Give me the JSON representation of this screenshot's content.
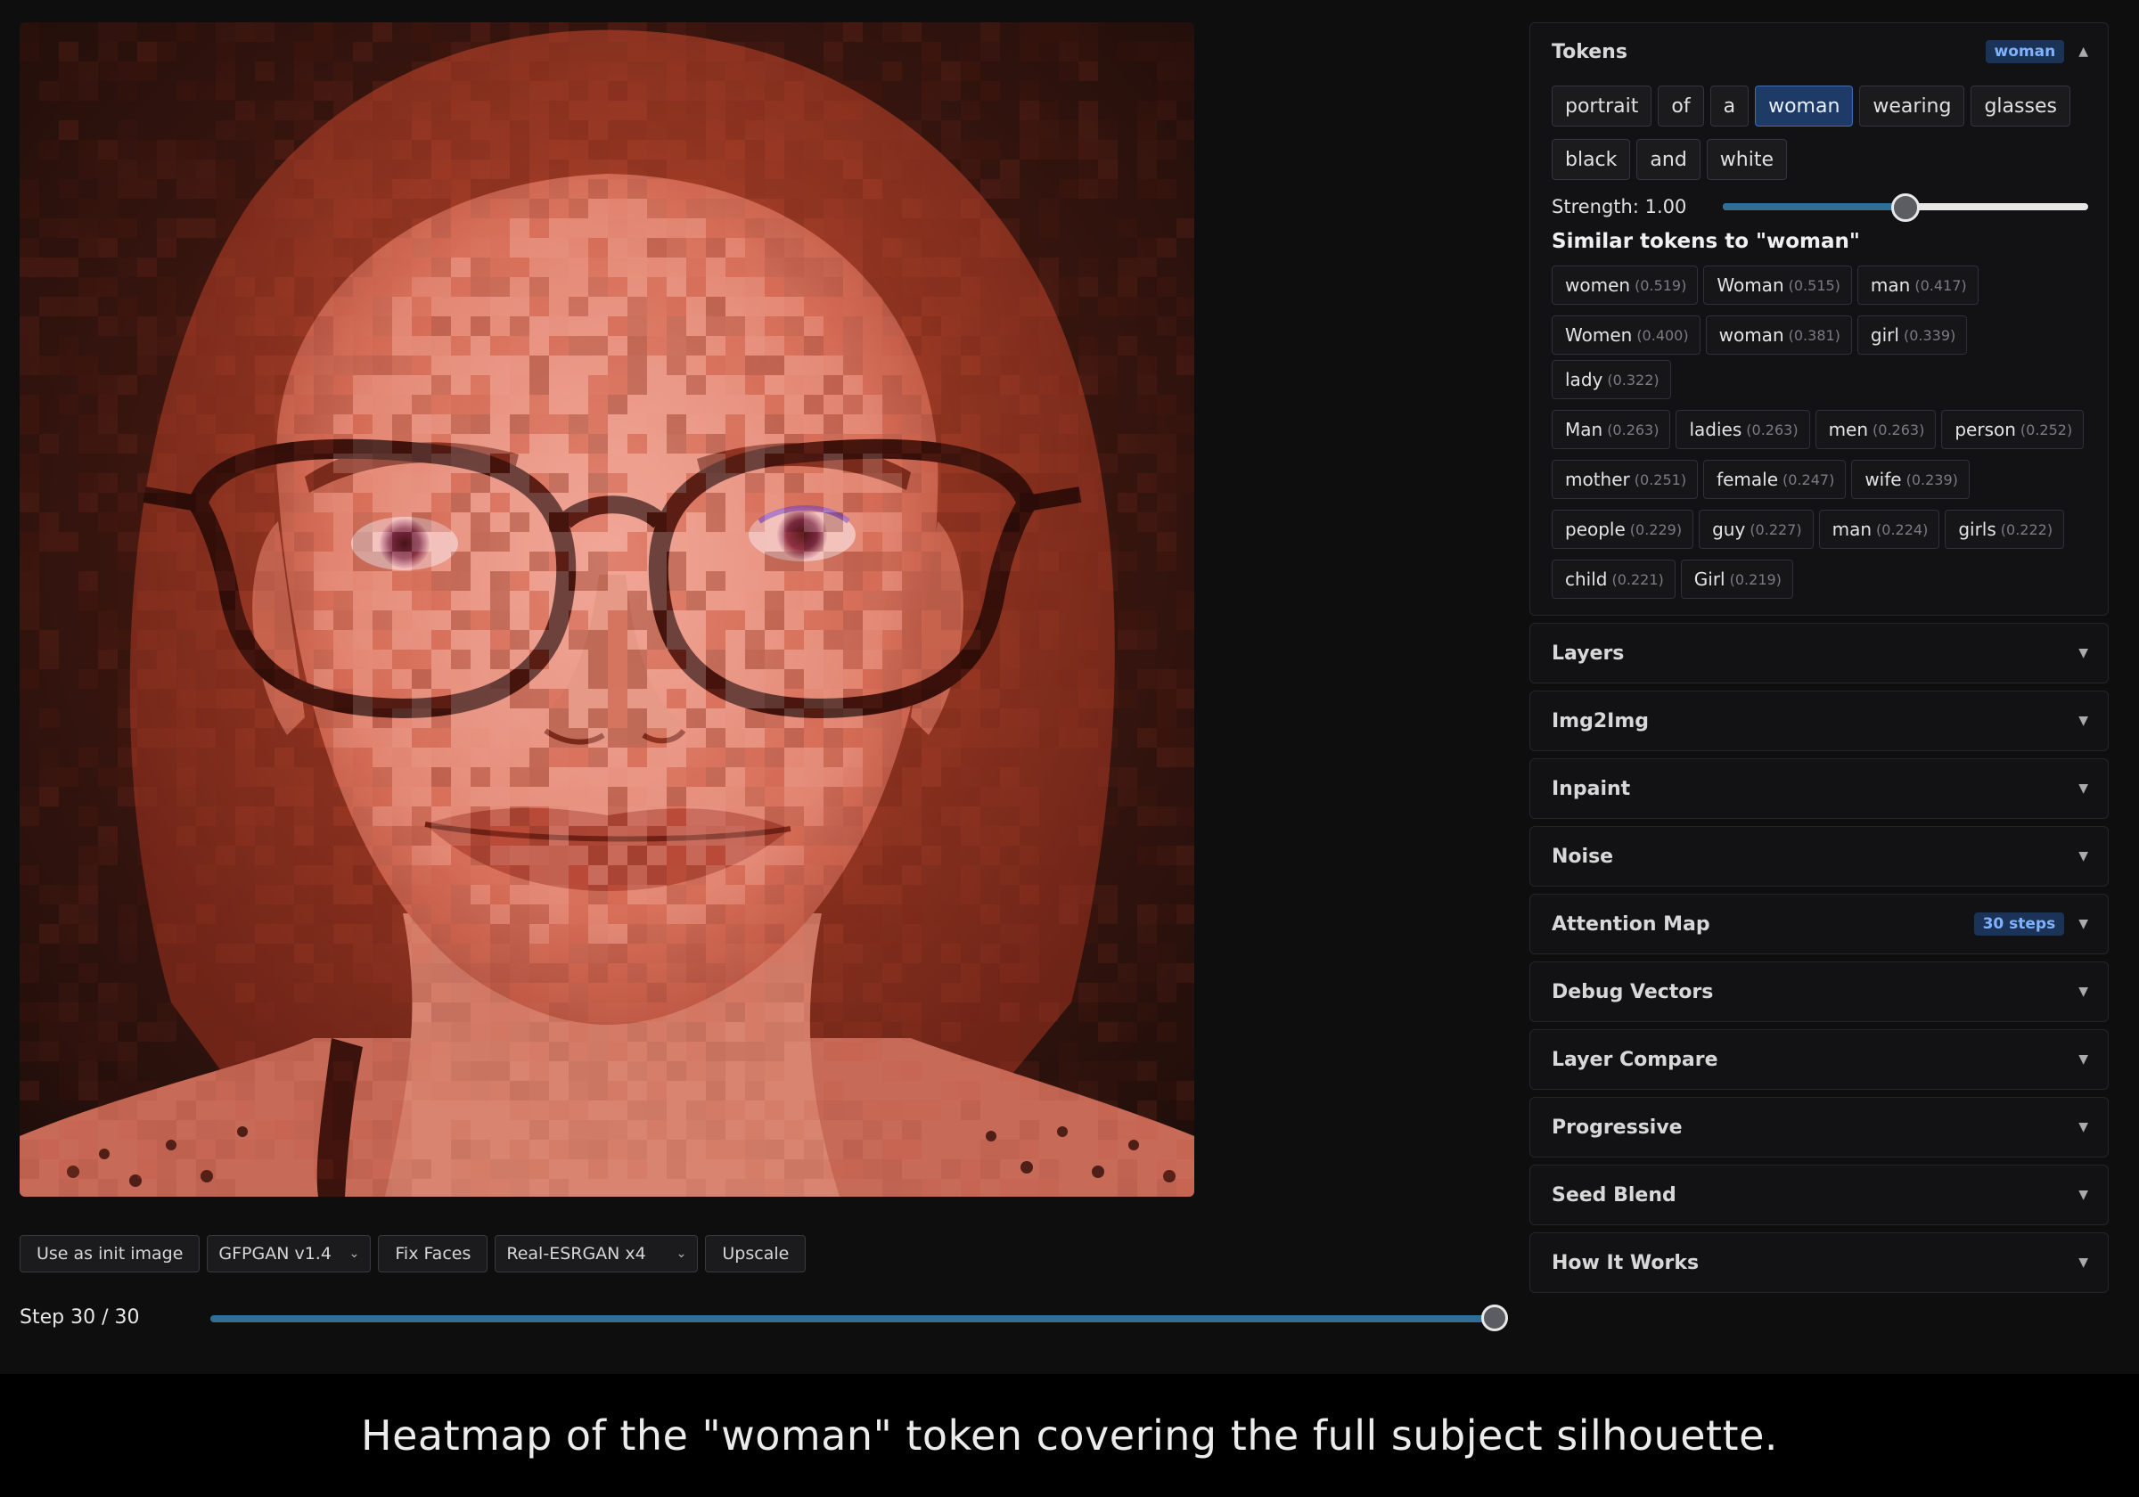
{
  "image_toolbar": {
    "use_init": "Use as init image",
    "face_model": "GFPGAN v1.4",
    "fix_faces": "Fix Faces",
    "upscaler": "Real-ESRGAN x4",
    "upscale": "Upscale"
  },
  "step": {
    "label": "Step 30 / 30",
    "current": 30,
    "total": 30
  },
  "caption": "Heatmap of the \"woman\" token covering the full subject silhouette.",
  "tokens": {
    "title": "Tokens",
    "badge": "woman",
    "items": [
      "portrait",
      "of",
      "a",
      "woman",
      "wearing",
      "glasses",
      "black",
      "and",
      "white"
    ],
    "active": "woman",
    "strength_label": "Strength: 1.00",
    "strength": 1.0,
    "strength_min": 0,
    "strength_max": 2,
    "similar_title": "Similar tokens to \"woman\"",
    "similar": [
      {
        "word": "women",
        "score": "(0.519)"
      },
      {
        "word": "Woman",
        "score": "(0.515)"
      },
      {
        "word": "man",
        "score": "(0.417)"
      },
      {
        "word": "Women",
        "score": "(0.400)"
      },
      {
        "word": "woman",
        "score": "(0.381)"
      },
      {
        "word": "girl",
        "score": "(0.339)"
      },
      {
        "word": "lady",
        "score": "(0.322)"
      },
      {
        "word": "Man",
        "score": "(0.263)"
      },
      {
        "word": "ladies",
        "score": "(0.263)"
      },
      {
        "word": "men",
        "score": "(0.263)"
      },
      {
        "word": "person",
        "score": "(0.252)"
      },
      {
        "word": "mother",
        "score": "(0.251)"
      },
      {
        "word": "female",
        "score": "(0.247)"
      },
      {
        "word": "wife",
        "score": "(0.239)"
      },
      {
        "word": "people",
        "score": "(0.229)"
      },
      {
        "word": "guy",
        "score": "(0.227)"
      },
      {
        "word": "man",
        "score": "(0.224)"
      },
      {
        "word": "girls",
        "score": "(0.222)"
      },
      {
        "word": "child",
        "score": "(0.221)"
      },
      {
        "word": "Girl",
        "score": "(0.219)"
      }
    ]
  },
  "sections": [
    {
      "title": "Layers",
      "badge": ""
    },
    {
      "title": "Img2Img",
      "badge": ""
    },
    {
      "title": "Inpaint",
      "badge": ""
    },
    {
      "title": "Noise",
      "badge": ""
    },
    {
      "title": "Attention Map",
      "badge": "30 steps"
    },
    {
      "title": "Debug Vectors",
      "badge": ""
    },
    {
      "title": "Layer Compare",
      "badge": ""
    },
    {
      "title": "Progressive",
      "badge": ""
    },
    {
      "title": "Seed Blend",
      "badge": ""
    },
    {
      "title": "How It Works",
      "badge": ""
    }
  ],
  "icons": {
    "expanded": "chevron-up-icon",
    "collapsed": "chevron-down-icon",
    "select": "chevron-down-icon"
  },
  "colors": {
    "accent": "#2f6f95",
    "active_chip": "#1e3a66",
    "badge_text": "#7fb2ff",
    "heat": "#c0452f"
  }
}
